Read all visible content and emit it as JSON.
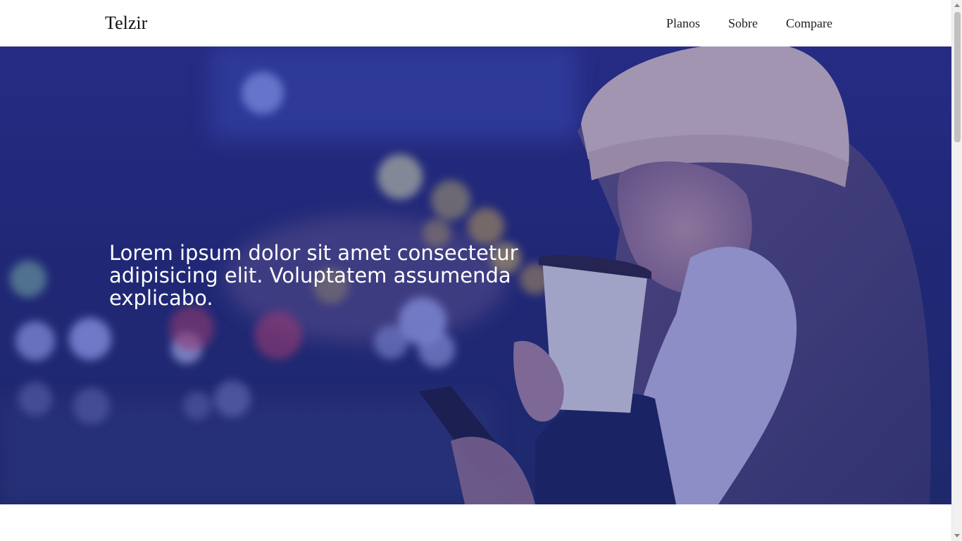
{
  "header": {
    "brand": "Telzir",
    "nav": [
      {
        "label": "Planos"
      },
      {
        "label": "Sobre"
      },
      {
        "label": "Compare"
      }
    ]
  },
  "hero": {
    "headline": "Lorem ipsum dolor sit amet consectetur adipisicing elit. Voluptatem assumenda explicabo."
  },
  "colors": {
    "overlay": "#232a76",
    "headline_text": "#ffffff"
  }
}
